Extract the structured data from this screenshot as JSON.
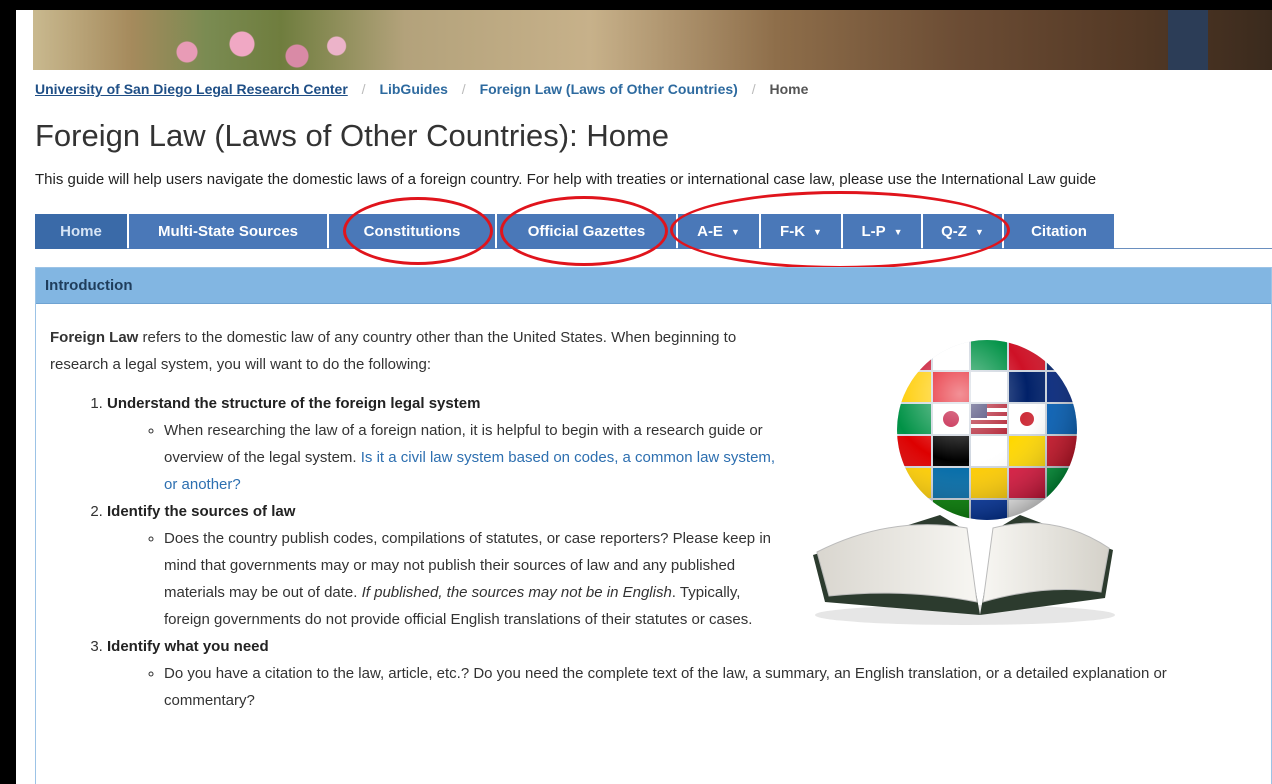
{
  "breadcrumb": {
    "items": [
      "University of San Diego Legal Research Center",
      "LibGuides",
      "Foreign Law (Laws of Other Countries)",
      "Home"
    ],
    "separator": "/"
  },
  "page": {
    "title": "Foreign Law (Laws of Other Countries): Home",
    "description": "This guide will help users navigate the domestic laws of a foreign country. For help with treaties or international case law, please use the International Law guide"
  },
  "tabs": [
    {
      "label": "Home",
      "active": true
    },
    {
      "label": "Multi-State Sources"
    },
    {
      "label": "Constitutions"
    },
    {
      "label": "Official Gazettes"
    },
    {
      "label": "A-E",
      "dropdown": true
    },
    {
      "label": "F-K",
      "dropdown": true
    },
    {
      "label": "L-P",
      "dropdown": true
    },
    {
      "label": "Q-Z",
      "dropdown": true
    },
    {
      "label": "Citation"
    }
  ],
  "panel": {
    "heading": "Introduction",
    "intro_bold": "Foreign Law",
    "intro_rest": " refers to the domestic law of any country other than the United States. When beginning to research a legal system, you will want to do the following:",
    "steps": [
      {
        "title": "Understand the structure of the foreign legal system",
        "sub_text": "When researching the law of a foreign nation, it is helpful to begin with a research guide or overview of the legal system. ",
        "sub_link": "Is it a civil law system based on codes, a common law system, or another?"
      },
      {
        "title": "Identify the sources of law",
        "sub_text_1": "Does the country publish codes, compilations of statutes, or case reporters? Please keep in mind that governments may or may not publish their sources of law and any published materials may be out of date. ",
        "sub_italic": "If published, the sources may not be in English",
        "sub_text_2": ". Typically, foreign governments do not provide official English translations of their statutes or cases."
      },
      {
        "title": "Identify what you need",
        "sub_text": "Do you have a citation to the law, article, etc.? Do you need the complete text of the law, a summary, an English translation, or a detailed explanation or commentary?"
      }
    ]
  },
  "colors": {
    "tab_bg": "#4a78b8",
    "panel_header": "#82b6e2",
    "annotation": "#e0141c",
    "link": "#2d6fb0"
  }
}
